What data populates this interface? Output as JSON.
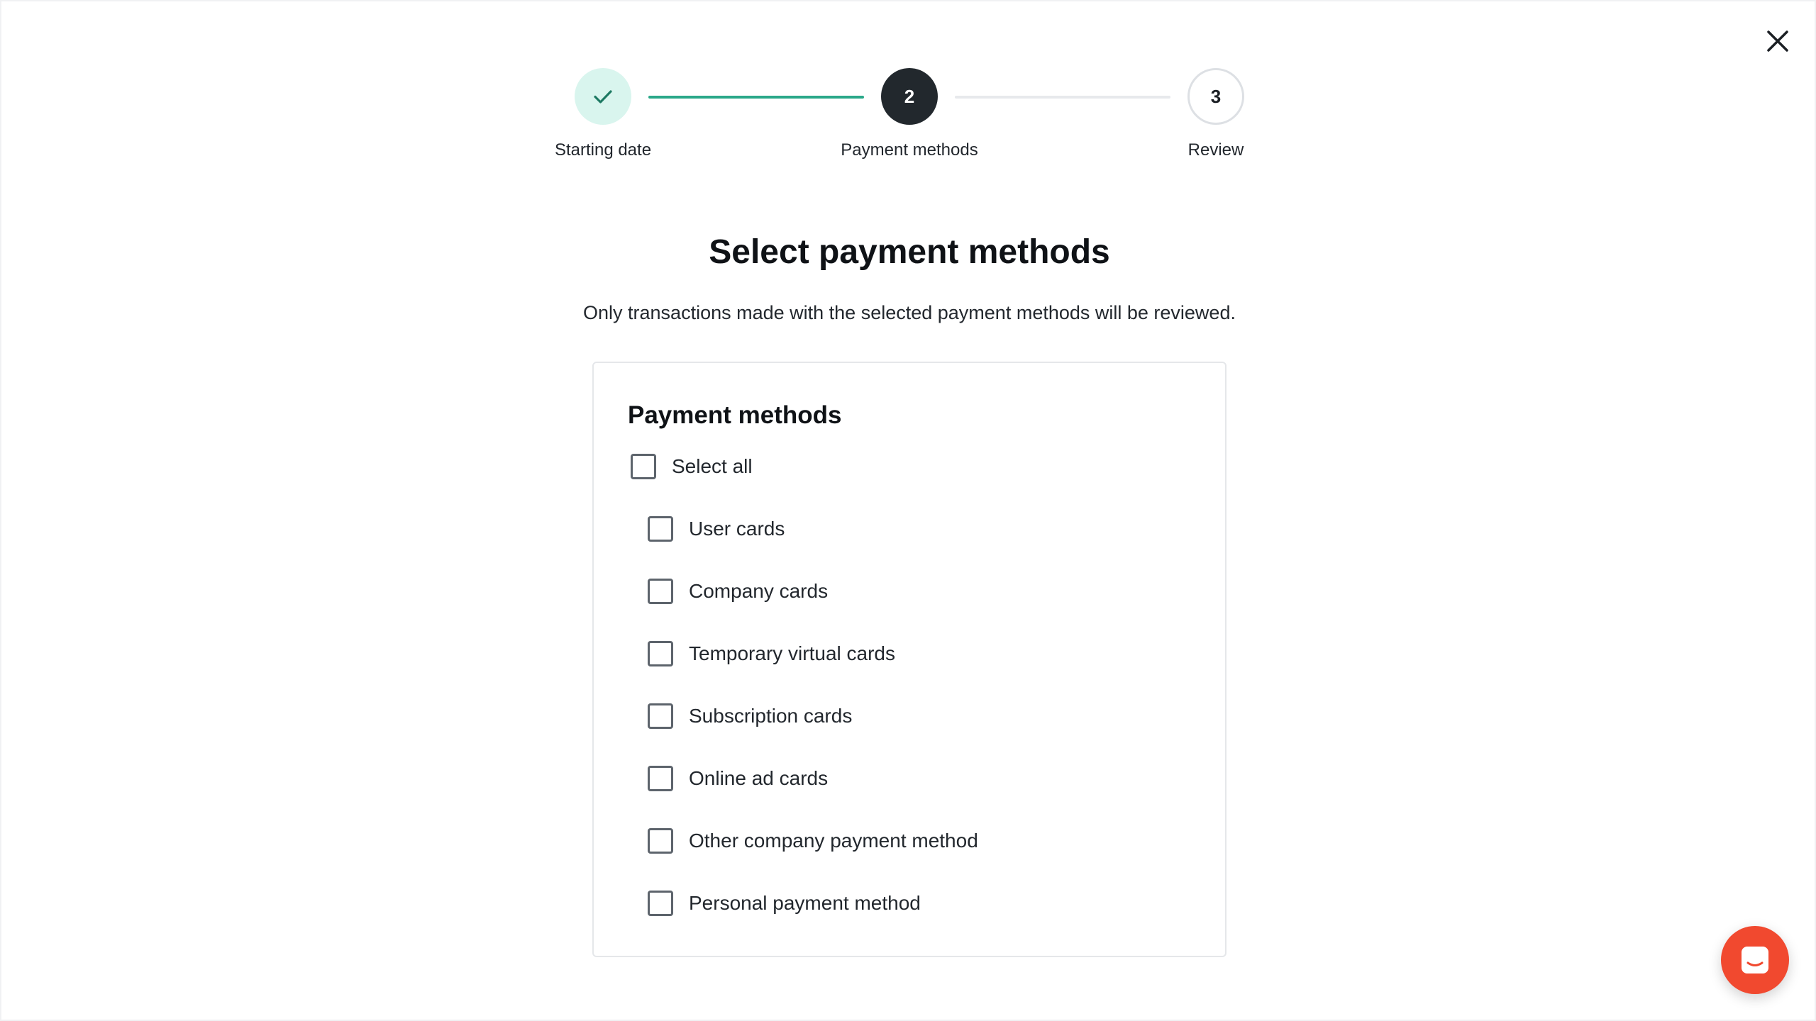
{
  "window": {
    "close_icon": "close-icon"
  },
  "stepper": {
    "steps": [
      {
        "label": "Starting date",
        "number": "",
        "state": "completed",
        "icon": "checkmark-icon"
      },
      {
        "label": "Payment methods",
        "number": "2",
        "state": "active"
      },
      {
        "label": "Review",
        "number": "3",
        "state": "pending"
      }
    ],
    "colors": {
      "completed_bg": "#d9f5ee",
      "completed_line": "#2aa889",
      "active_bg": "#22282d",
      "pending_line": "#e7e9ec"
    }
  },
  "header": {
    "title": "Select payment methods",
    "subtitle": "Only transactions made with the selected payment methods will be reviewed."
  },
  "card": {
    "title": "Payment methods",
    "select_all": {
      "label": "Select all",
      "checked": false
    },
    "options": [
      {
        "label": "User cards",
        "checked": false
      },
      {
        "label": "Company cards",
        "checked": false
      },
      {
        "label": "Temporary virtual cards",
        "checked": false
      },
      {
        "label": "Subscription cards",
        "checked": false
      },
      {
        "label": "Online ad cards",
        "checked": false
      },
      {
        "label": "Other company payment method",
        "checked": false
      },
      {
        "label": "Personal payment method",
        "checked": false
      }
    ]
  },
  "chat": {
    "icon": "chat-icon",
    "color": "#f1492f"
  }
}
